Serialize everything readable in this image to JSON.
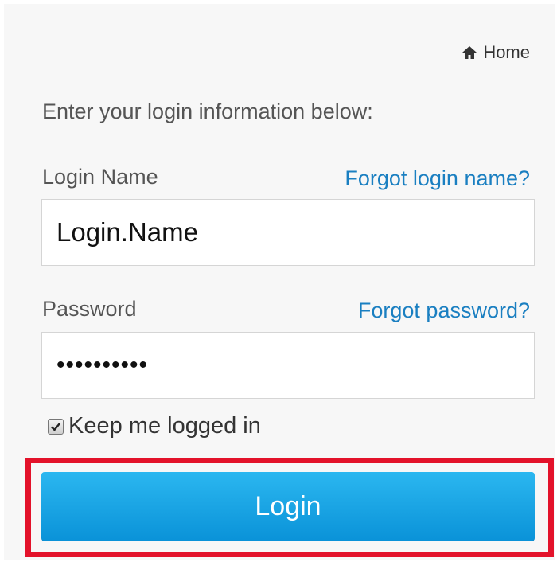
{
  "header": {
    "home_label": "Home",
    "home_icon": "home-icon"
  },
  "form": {
    "intro": "Enter your login information below:",
    "login_name": {
      "label": "Login Name",
      "forgot_label": "Forgot login name?",
      "value": "Login.Name"
    },
    "password": {
      "label": "Password",
      "forgot_label": "Forgot password?",
      "value": "Password!1"
    },
    "keep_logged_in": {
      "label": "Keep me logged in",
      "checked": true
    },
    "submit_label": "Login"
  },
  "colors": {
    "panel_background": "#f7f7f7",
    "link": "#1a7fc1",
    "button": "#0a92d8",
    "highlight": "#e3122a"
  }
}
